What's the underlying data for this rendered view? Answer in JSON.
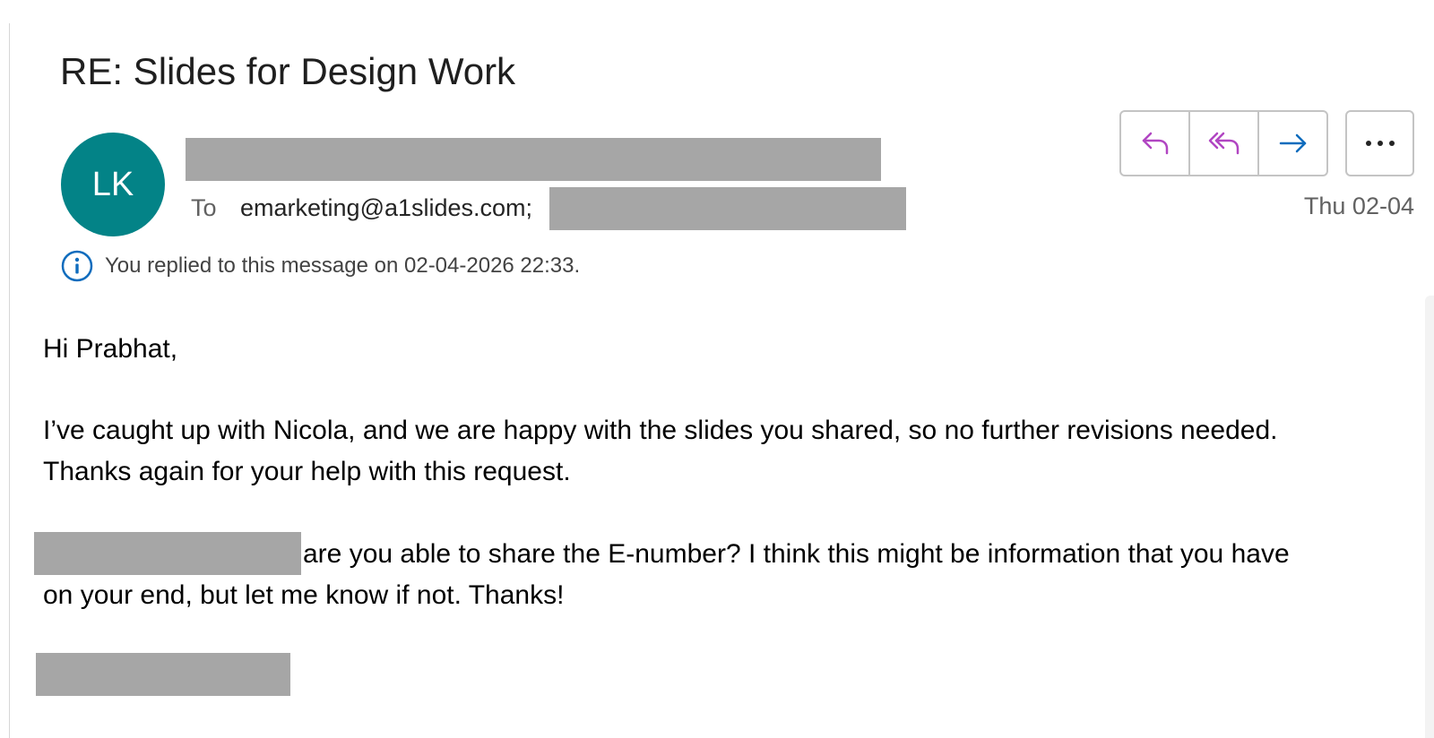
{
  "email": {
    "subject": "RE: Slides for Design Work",
    "sender_initials": "LK",
    "to_label": "To",
    "to_address": "emarketing@a1slides.com;",
    "date": "Thu 02-04",
    "info_notice": "You replied to this message on 02-04-2026 22:33."
  },
  "actions": {
    "icons": [
      "reply-icon",
      "reply-all-icon",
      "forward-icon",
      "more-options-icon"
    ],
    "reply_color": "#b146c2",
    "forward_color": "#0f6cbd"
  },
  "body": {
    "greeting": "Hi Prabhat,",
    "paragraph1_line1": "I’ve caught up with Nicola, and we are happy with the slides you shared, so no further revisions needed.",
    "paragraph1_line2": "Thanks again for your help with this request.",
    "paragraph2_line1": "are you able to share the E-number? I think this might be information that you have",
    "paragraph2_line2": "on your end, but let me know if not. Thanks!"
  },
  "colors": {
    "avatar_bg": "#038387",
    "redaction": "#a6a6a6",
    "info_icon": "#0f6cbd"
  }
}
